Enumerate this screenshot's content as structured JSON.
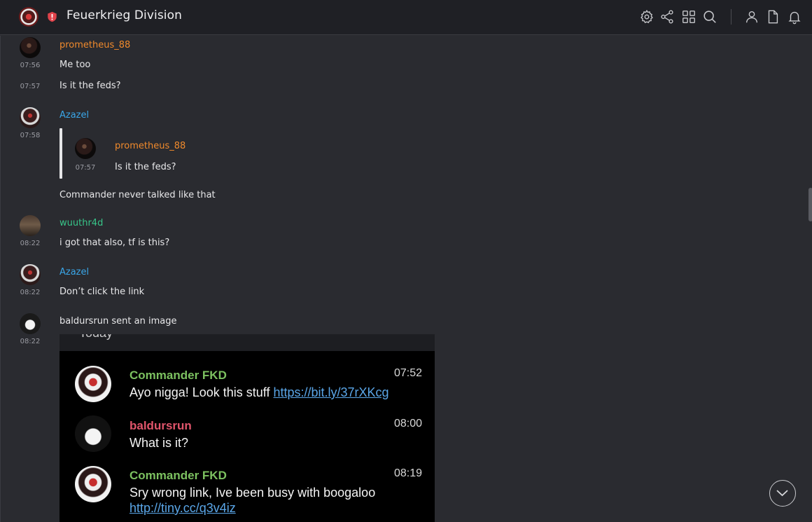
{
  "header": {
    "room_name": "Feuerkrieg Division",
    "icons": [
      "room-avatar",
      "shield-alert-icon",
      "settings-icon",
      "share-icon",
      "apps-grid-icon",
      "search-icon",
      "members-icon",
      "files-icon",
      "notifications-bell-icon"
    ]
  },
  "colors": {
    "background": "#2a2b30",
    "header_bg": "#1f2025",
    "orange_sender": "#f08a2c",
    "blue_sender": "#3aa6e8",
    "green_sender": "#38c589",
    "shield_red": "#e0424a"
  },
  "timeline": {
    "messages": [
      {
        "sender": "prometheus_88",
        "time": "07:56",
        "text": "Me too"
      },
      {
        "time": "07:57",
        "text": "Is it the feds?"
      },
      {
        "sender": "Azazel",
        "time": "07:58",
        "quote": {
          "sender": "prometheus_88",
          "time": "07:57",
          "text": "Is it the feds?"
        },
        "text": "Commander never talked like that"
      },
      {
        "sender": "wuuthr4d",
        "time": "08:22",
        "text": "i got that also, tf is this?"
      },
      {
        "sender": "Azazel",
        "time": "08:22",
        "text": "Don’t click the link"
      },
      {
        "time": "08:22",
        "text": "baldursrun sent an image"
      }
    ]
  },
  "image": {
    "header_text": "Today",
    "chat": [
      {
        "name": "Commander FKD",
        "time": "07:52",
        "text": "Ayo nigga! Look this stuff ",
        "link": "https://bit.ly/37rXKcg"
      },
      {
        "name": "baldursrun",
        "time": "08:00",
        "text": "What is it?"
      },
      {
        "name": "Commander FKD",
        "time": "08:19",
        "text": "Sry wrong link, Ive been busy with boogaloo",
        "link": "http://tiny.cc/q3v4iz"
      }
    ]
  }
}
